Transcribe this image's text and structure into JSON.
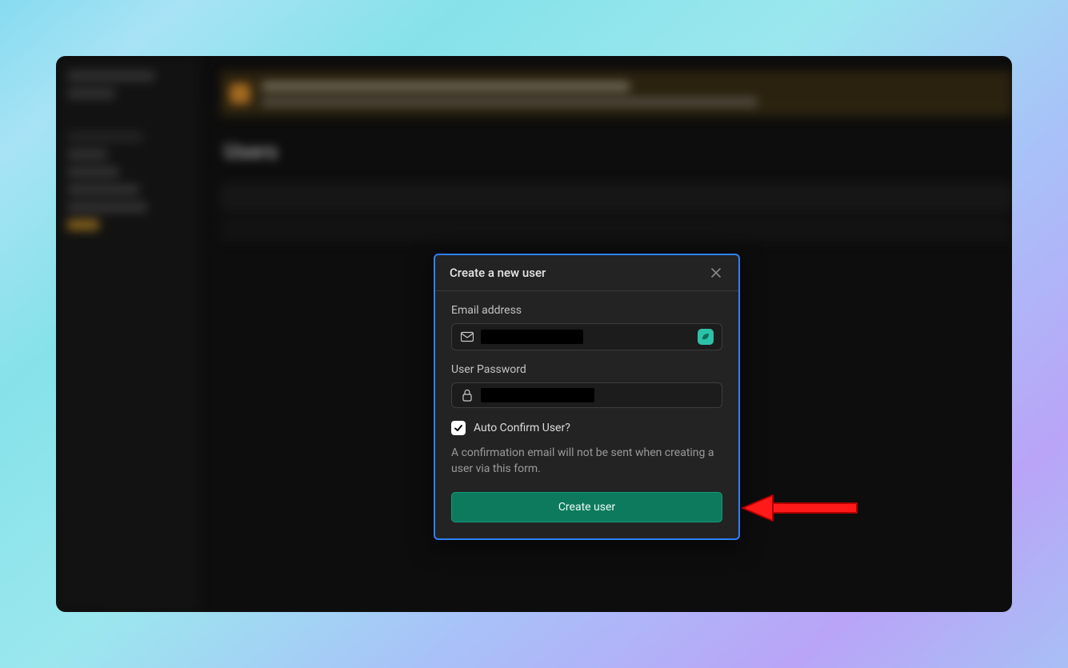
{
  "background": {
    "heading": "Users",
    "banner_title": "Authentication emails are only sent to organization members' email addresses",
    "banner_sub": "Set up a custom SMTP provider to handle these the password reset which requires sending emails to any user"
  },
  "modal": {
    "title": "Create a new user",
    "email_label": "Email address",
    "password_label": "User Password",
    "checkbox_label": "Auto Confirm User?",
    "checkbox_checked": true,
    "hint_text": "A confirmation email will not be sent when creating a user via this form.",
    "submit_label": "Create user"
  }
}
